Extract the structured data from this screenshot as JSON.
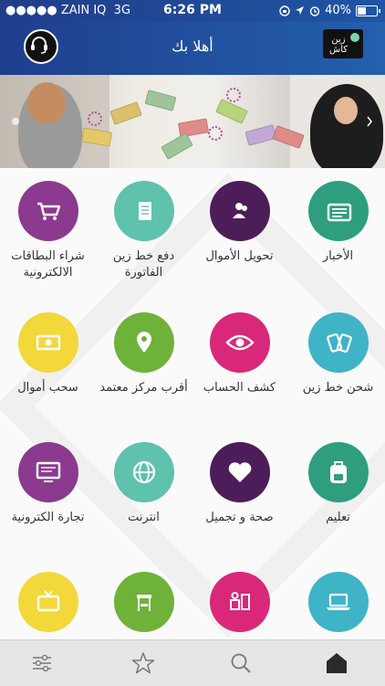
{
  "status_bar": {
    "carrier": "●●●●● ZAIN IQ",
    "network": "3G",
    "time": "6:26 PM",
    "battery": "40%",
    "battery_level": 0.4
  },
  "header": {
    "title": "أهلا بك",
    "zaincash_label": "زين كاش"
  },
  "grid": {
    "items": [
      {
        "label": "الأخبار",
        "color": "#2e9e7e",
        "icon": "newspaper-icon"
      },
      {
        "label": "تحويل الأموال",
        "color": "#4d1d59",
        "icon": "people-icon"
      },
      {
        "label": "دفع خط زين الفاتورة",
        "color": "#5fc2ad",
        "icon": "document-icon"
      },
      {
        "label": "شراء البطاقات الالكترونية",
        "color": "#8b3a8f",
        "icon": "cart-icon"
      },
      {
        "label": "شحن خط زين",
        "color": "#3fb4c6",
        "icon": "cards-icon"
      },
      {
        "label": "كشف الحساب",
        "color": "#d9287a",
        "icon": "eye-icon"
      },
      {
        "label": "أقرب مركز معتمد",
        "color": "#6fb23a",
        "icon": "location-pin-icon"
      },
      {
        "label": "سحب أموال",
        "color": "#f2d83a",
        "icon": "cash-icon"
      },
      {
        "label": "تعليم",
        "color": "#2e9e7e",
        "icon": "backpack-icon"
      },
      {
        "label": "صحة و تجميل",
        "color": "#4d1d59",
        "icon": "heart-icon"
      },
      {
        "label": "انترنت",
        "color": "#5fc2ad",
        "icon": "globe-icon"
      },
      {
        "label": "تجارة الكترونية",
        "color": "#8b3a8f",
        "icon": "computer-icon"
      },
      {
        "label": "",
        "color": "#3fb4c6",
        "icon": "laptop-icon"
      },
      {
        "label": "",
        "color": "#d9287a",
        "icon": "appliances-icon"
      },
      {
        "label": "",
        "color": "#6fb23a",
        "icon": "furniture-icon"
      },
      {
        "label": "",
        "color": "#f2d83a",
        "icon": "tv-icon"
      }
    ]
  },
  "tabbar": {
    "tabs": [
      {
        "icon": "sliders-icon"
      },
      {
        "icon": "star-icon"
      },
      {
        "icon": "search-icon"
      },
      {
        "icon": "home-icon",
        "active": true
      }
    ]
  }
}
